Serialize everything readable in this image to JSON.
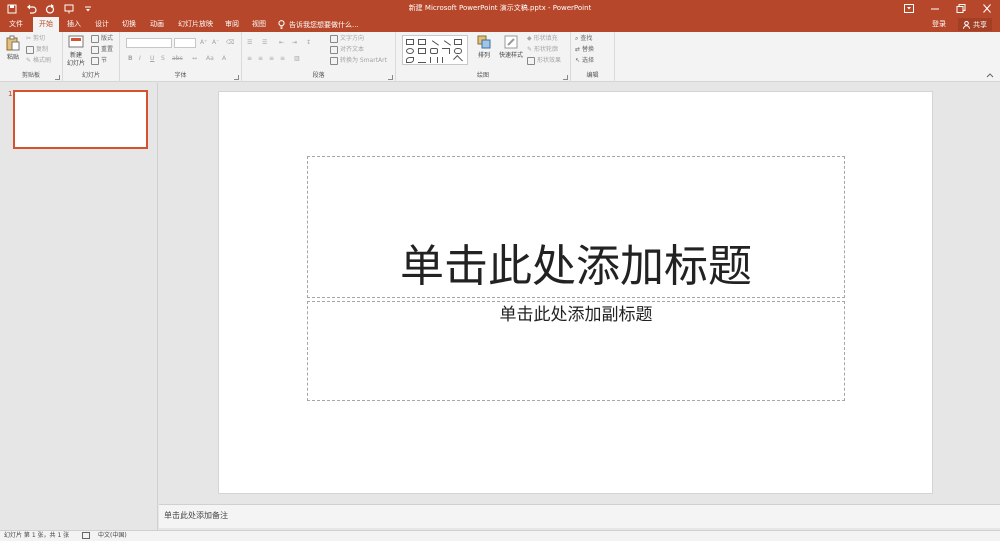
{
  "app": {
    "window_title": "新建 Microsoft PowerPoint 演示文稿.pptx - PowerPoint",
    "brand_color": "#b7472a"
  },
  "titlebar": {
    "quick_access": [
      "save-icon",
      "undo-icon",
      "redo-icon",
      "start-from-beginning-icon",
      "customize-qat-icon"
    ],
    "window_controls": [
      "ribbon-display-options-icon",
      "minimize-icon",
      "restore-icon",
      "close-icon"
    ]
  },
  "ribbon_tabs": {
    "items": [
      "文件",
      "开始",
      "插入",
      "设计",
      "切换",
      "动画",
      "幻灯片放映",
      "审阅",
      "视图"
    ],
    "active": "开始",
    "tell_me": "告诉我您想要做什么...",
    "sign_in": "登录",
    "share": "共享"
  },
  "ribbon": {
    "clipboard": {
      "label": "剪贴板",
      "paste": "粘贴",
      "cut": "剪切",
      "copy": "复制",
      "format_painter": "格式刷"
    },
    "slides": {
      "label": "幻灯片",
      "new_slide": "新建",
      "new_slide_2": "幻灯片",
      "layout": "版式",
      "reset": "重置",
      "section": "节"
    },
    "font": {
      "label": "字体",
      "bold": "B",
      "italic": "I",
      "underline": "U",
      "strikethrough": "S",
      "shadow": "abc"
    },
    "paragraph": {
      "label": "段落",
      "text_direction": "文字方向",
      "align_text": "对齐文本",
      "convert_smartart": "转换为 SmartArt"
    },
    "drawing": {
      "label": "绘图",
      "arrange": "排列",
      "quick_styles": "快速样式",
      "shape_fill": "形状填充",
      "shape_outline": "形状轮廓",
      "shape_effects": "形状效果"
    },
    "editing": {
      "label": "编辑",
      "find": "查找",
      "replace": "替换",
      "select": "选择"
    }
  },
  "thumbnails": {
    "slide_number": "1"
  },
  "slide": {
    "title_placeholder": "单击此处添加标题",
    "subtitle_placeholder": "单击此处添加副标题"
  },
  "notes": {
    "placeholder": "单击此处添加备注"
  },
  "statusbar": {
    "slide_info": "幻灯片 第 1 张，共 1 张",
    "language": "中文(中国)"
  }
}
